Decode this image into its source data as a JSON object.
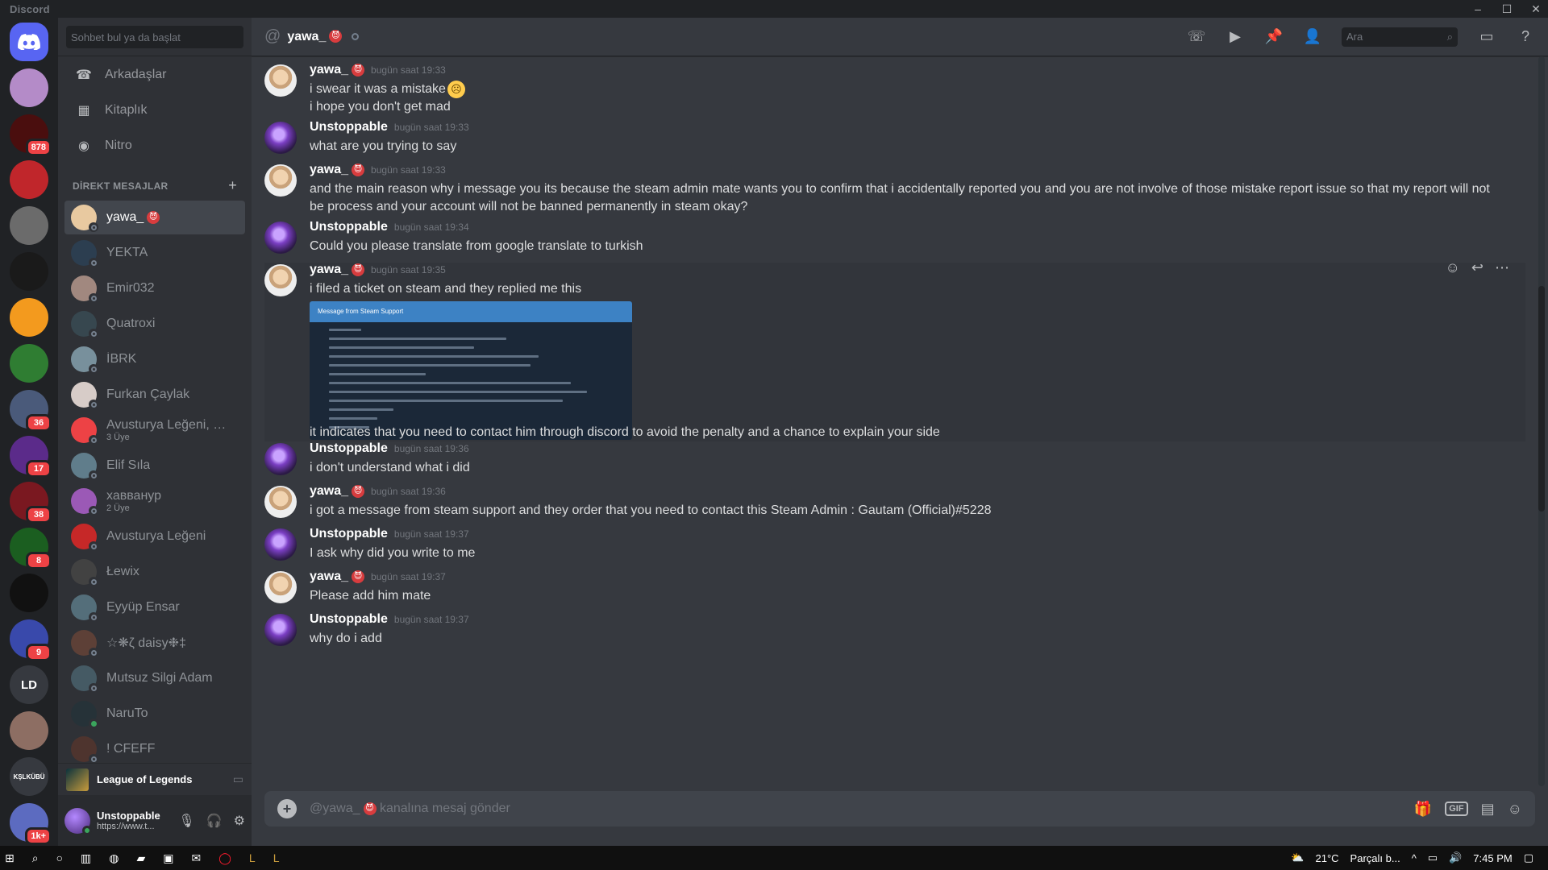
{
  "app": {
    "title": "Discord"
  },
  "window_controls": {
    "minimize": "–",
    "maximize": "☐",
    "close": "✕"
  },
  "guilds": [
    {
      "label": "",
      "color": "#b48bc8",
      "badge": ""
    },
    {
      "label": "",
      "color": "#4a0e0e",
      "badge": "878"
    },
    {
      "label": "",
      "color": "#c0262b",
      "badge": ""
    },
    {
      "label": "",
      "color": "#6b6b6b",
      "badge": ""
    },
    {
      "label": "",
      "color": "#1a1a1a",
      "badge": ""
    },
    {
      "label": "",
      "color": "#f39a1e",
      "badge": ""
    },
    {
      "label": "",
      "color": "#2f7d32",
      "badge": ""
    },
    {
      "label": "",
      "color": "#4a5a7a",
      "badge": "36"
    },
    {
      "label": "",
      "color": "#5b2b8a",
      "badge": "17"
    },
    {
      "label": "",
      "color": "#7a1820",
      "badge": "38"
    },
    {
      "label": "",
      "color": "#1b5e20",
      "badge": "8"
    },
    {
      "label": "",
      "color": "#111111",
      "badge": ""
    },
    {
      "label": "",
      "color": "#3949ab",
      "badge": "9"
    },
    {
      "label": "LD",
      "color": "#36393f",
      "badge": ""
    },
    {
      "label": "",
      "color": "#8d6e63",
      "badge": ""
    },
    {
      "label": "KŞLKÜBÜ",
      "color": "#36393f",
      "badge": ""
    },
    {
      "label": "",
      "color": "#5c6bc0",
      "badge": "1k+"
    }
  ],
  "dm_panel": {
    "search_placeholder": "Sohbet bul ya da başlat",
    "nav": [
      {
        "label": "Arkadaşlar",
        "icon": "☎"
      },
      {
        "label": "Kitaplık",
        "icon": "▦"
      },
      {
        "label": "Nitro",
        "icon": "◉"
      }
    ],
    "section_title": "DİREKT MESAJLAR",
    "add_label": "+",
    "dms": [
      {
        "name": "yawa_",
        "sub": "",
        "color": "#e8c9a0",
        "online": false,
        "emoji": "😈"
      },
      {
        "name": "YEKTA",
        "sub": "",
        "color": "#2c3e50",
        "online": false,
        "emoji": ""
      },
      {
        "name": "Emir032",
        "sub": "",
        "color": "#a1887f",
        "online": false,
        "emoji": ""
      },
      {
        "name": "Quatroxi",
        "sub": "",
        "color": "#37474f",
        "online": false,
        "emoji": ""
      },
      {
        "name": "İBRK",
        "sub": "",
        "color": "#78909c",
        "online": false,
        "emoji": ""
      },
      {
        "name": "Furkan Çaylak",
        "sub": "",
        "color": "#d7ccc8",
        "online": false,
        "emoji": ""
      },
      {
        "name": "Avusturya Leğeni, Łe...",
        "sub": "3 Üye",
        "color": "#ed4245",
        "online": false,
        "emoji": ""
      },
      {
        "name": "Elif Sıla",
        "sub": "",
        "color": "#607d8b",
        "online": false,
        "emoji": ""
      },
      {
        "name": "хавванур",
        "sub": "2 Üye",
        "color": "#9b59b6",
        "online": false,
        "emoji": ""
      },
      {
        "name": "Avusturya Leğeni",
        "sub": "",
        "color": "#c62828",
        "online": false,
        "emoji": ""
      },
      {
        "name": "Łewix",
        "sub": "",
        "color": "#424242",
        "online": false,
        "emoji": ""
      },
      {
        "name": "Eyyüp Ensar",
        "sub": "",
        "color": "#546e7a",
        "online": false,
        "emoji": ""
      },
      {
        "name": "☆❋ζ daisy❉‡",
        "sub": "",
        "color": "#5d4037",
        "online": false,
        "emoji": ""
      },
      {
        "name": "Mutsuz Silgi Adam",
        "sub": "",
        "color": "#455a64",
        "online": false,
        "emoji": ""
      },
      {
        "name": "NaruTo",
        "sub": "",
        "color": "#263238",
        "online": true,
        "emoji": ""
      },
      {
        "name": "! CFEFF",
        "sub": "",
        "color": "#4e342e",
        "online": false,
        "emoji": ""
      }
    ]
  },
  "activity": {
    "title": "League of Legends"
  },
  "user": {
    "name": "Unstoppable",
    "status": "https://www.t..."
  },
  "channel": {
    "name": "yawa_",
    "emoji": "😈"
  },
  "top_search_placeholder": "Ara",
  "messages": [
    {
      "author": "yawa_",
      "av": "yawa",
      "time": "bugün saat 19:33",
      "lines": [
        "i swear it was a mistake",
        "i hope you don't get mad"
      ],
      "frown_on_first": true
    },
    {
      "author": "Unstoppable",
      "av": "unst",
      "time": "bugün saat 19:33",
      "lines": [
        "what are you trying to say"
      ]
    },
    {
      "author": "yawa_",
      "av": "yawa",
      "time": "bugün saat 19:33",
      "lines": [
        "and the main reason why i message you its because the steam admin mate wants you to confirm that i accidentally reported you and you are not involve of those mistake report issue so that my report will not be process and your account will not be banned permanently in steam okay?"
      ]
    },
    {
      "author": "Unstoppable",
      "av": "unst",
      "time": "bugün saat 19:34",
      "lines": [
        "Could you please translate from google translate to turkish"
      ]
    },
    {
      "author": "yawa_",
      "av": "yawa",
      "time": "bugün saat 19:35",
      "lines": [
        "i filed a ticket on steam and they replied me this"
      ],
      "attachment_title": "Message from Steam Support",
      "after": "it indicates that you need to contact him through discord to avoid the penalty and a chance to explain your side"
    },
    {
      "author": "Unstoppable",
      "av": "unst",
      "time": "bugün saat 19:36",
      "lines": [
        "i don't understand what i did"
      ]
    },
    {
      "author": "yawa_",
      "av": "yawa",
      "time": "bugün saat 19:36",
      "lines": [
        "i got a message from steam support and they order that you need to contact this Steam Admin :   Gautam (Official)#5228"
      ]
    },
    {
      "author": "Unstoppable",
      "av": "unst",
      "time": "bugün saat 19:37",
      "lines": [
        "I ask why did you write to me"
      ]
    },
    {
      "author": "yawa_",
      "av": "yawa",
      "time": "bugün saat 19:37",
      "lines": [
        "Please add him mate"
      ]
    },
    {
      "author": "Unstoppable",
      "av": "unst",
      "time": "bugün saat 19:37",
      "lines": [
        "why do i add"
      ]
    }
  ],
  "composer": {
    "prefix": "@yawa_",
    "suffix": " kanalına mesaj gönder"
  },
  "taskbar": {
    "temp": "21°C",
    "weather": "Parçalı b...",
    "time": "7:45 PM"
  }
}
